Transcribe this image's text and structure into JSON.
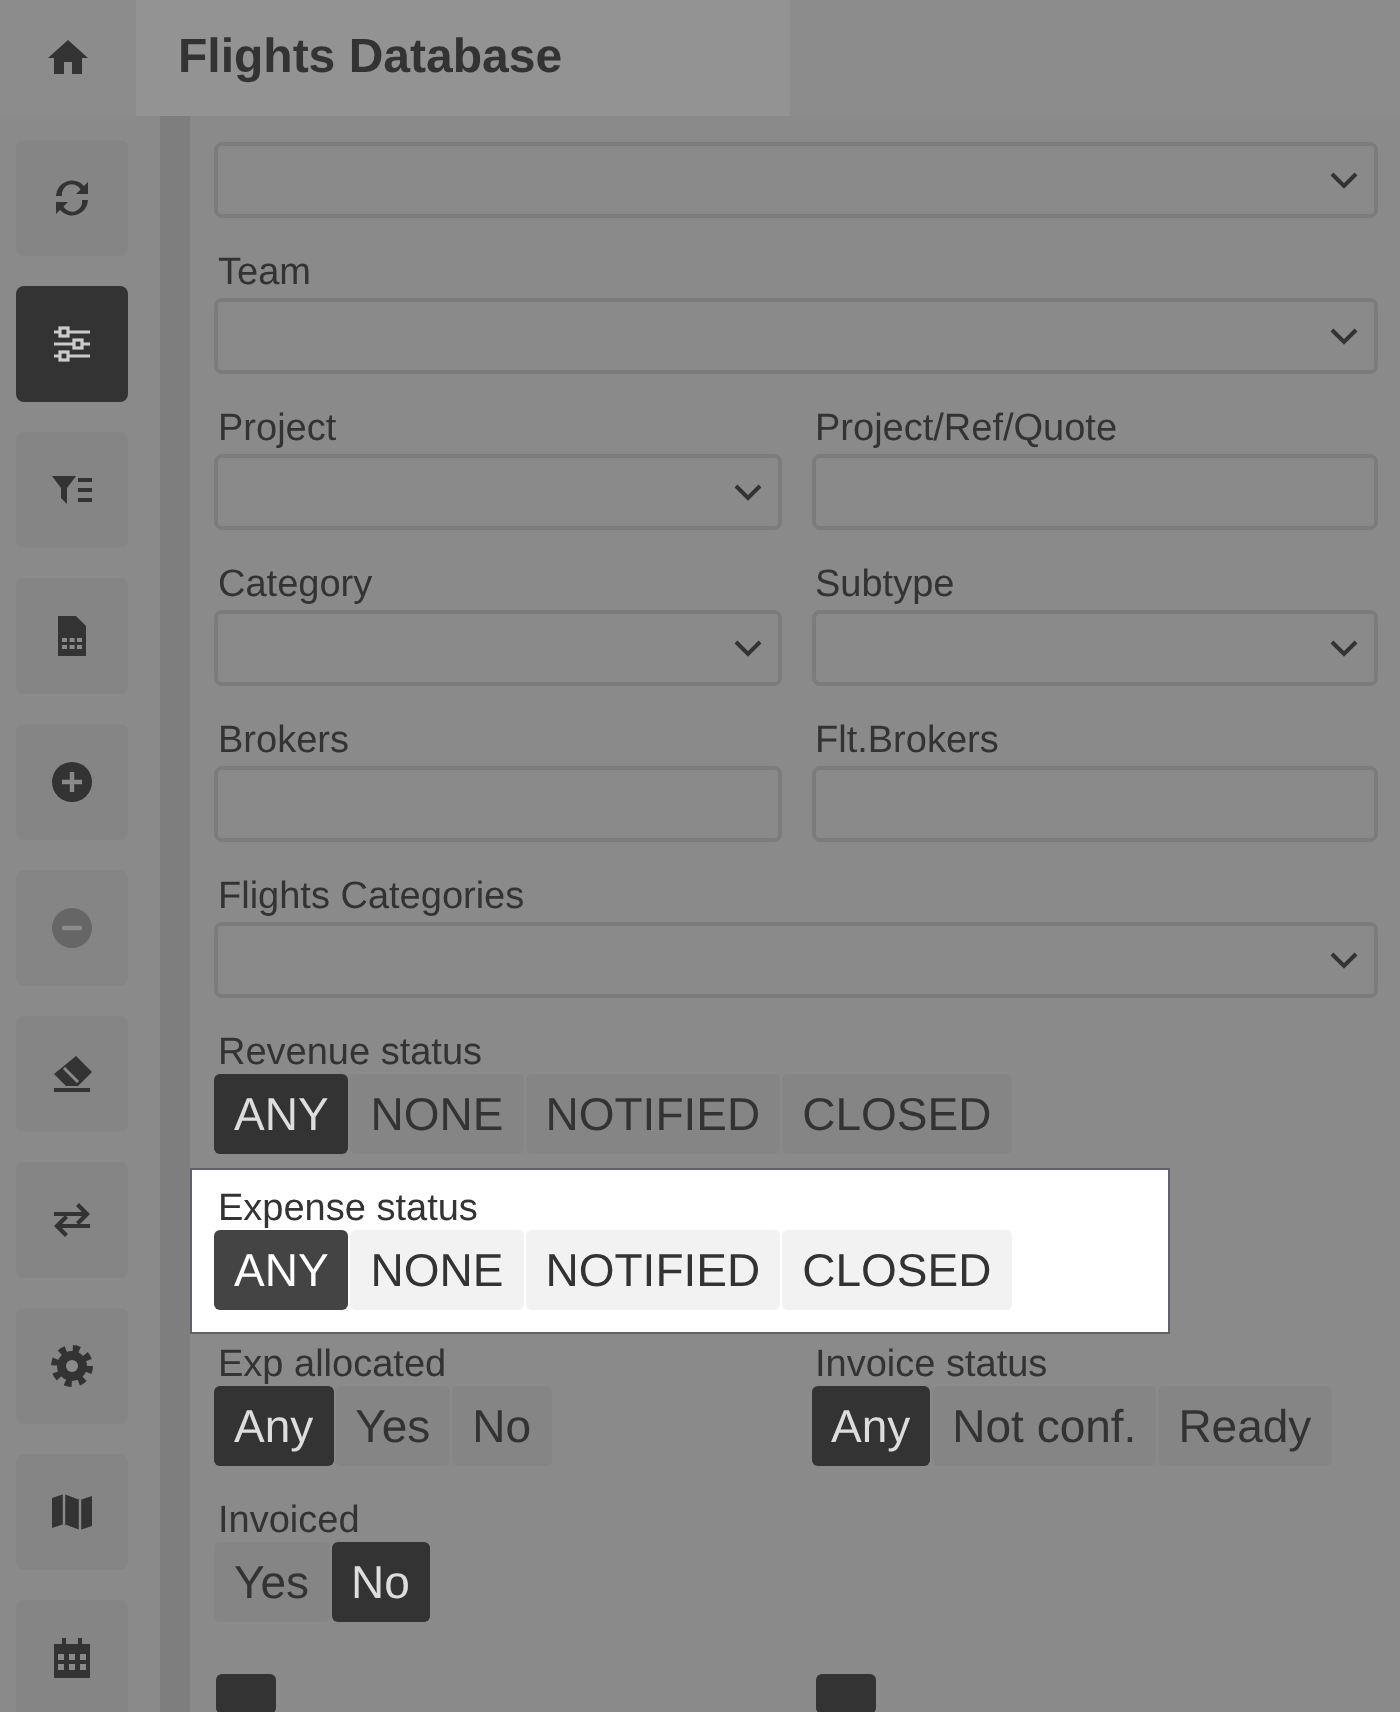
{
  "header": {
    "title": "Flights Database"
  },
  "sidebar": {
    "items": [
      {
        "selected": false,
        "disabled": false
      },
      {
        "selected": true,
        "disabled": false
      },
      {
        "selected": false,
        "disabled": false
      },
      {
        "selected": false,
        "disabled": false
      },
      {
        "selected": false,
        "disabled": false
      },
      {
        "selected": false,
        "disabled": true
      },
      {
        "selected": false,
        "disabled": false
      },
      {
        "selected": false,
        "disabled": false
      },
      {
        "selected": false,
        "disabled": false
      },
      {
        "selected": false,
        "disabled": false
      },
      {
        "selected": false,
        "disabled": false
      }
    ]
  },
  "form": {
    "rows": [
      {
        "kind": "fields",
        "fields": [
          {
            "kind": "select"
          }
        ]
      },
      {
        "kind": "fields",
        "fields": [
          {
            "label": "Team",
            "kind": "select"
          }
        ]
      },
      {
        "kind": "fields",
        "fields": [
          {
            "label": "Project",
            "kind": "select"
          },
          {
            "label": "Project/Ref/Quote",
            "kind": "text"
          }
        ]
      },
      {
        "kind": "fields",
        "fields": [
          {
            "label": "Category",
            "kind": "select"
          },
          {
            "label": "Subtype",
            "kind": "select"
          }
        ]
      },
      {
        "kind": "fields",
        "fields": [
          {
            "label": "Brokers",
            "kind": "text"
          },
          {
            "label": "Flt.Brokers",
            "kind": "text"
          }
        ]
      },
      {
        "kind": "fields",
        "fields": [
          {
            "label": "Flights Categories",
            "kind": "select"
          }
        ]
      },
      {
        "kind": "segments",
        "groups": [
          {
            "label": "Revenue status",
            "highlighted": false,
            "options": [
              {
                "label": "ANY",
                "selected": true
              },
              {
                "label": "NONE",
                "selected": false
              },
              {
                "label": "NOTIFIED",
                "selected": false
              },
              {
                "label": "CLOSED",
                "selected": false
              }
            ]
          }
        ]
      },
      {
        "kind": "segments",
        "groups": [
          {
            "label": "Expense status",
            "highlighted": true,
            "options": [
              {
                "label": "ANY",
                "selected": true
              },
              {
                "label": "NONE",
                "selected": false
              },
              {
                "label": "NOTIFIED",
                "selected": false
              },
              {
                "label": "CLOSED",
                "selected": false
              }
            ]
          }
        ]
      },
      {
        "kind": "segments",
        "groups": [
          {
            "label": "Exp allocated",
            "highlighted": false,
            "options": [
              {
                "label": "Any",
                "selected": true
              },
              {
                "label": "Yes",
                "selected": false
              },
              {
                "label": "No",
                "selected": false
              }
            ]
          },
          {
            "label": "Invoice status",
            "highlighted": false,
            "options": [
              {
                "label": "Any",
                "selected": true
              },
              {
                "label": "Not conf.",
                "selected": false
              },
              {
                "label": "Ready",
                "selected": false
              }
            ]
          }
        ]
      },
      {
        "kind": "segments",
        "groups": [
          {
            "label": "Invoiced",
            "highlighted": false,
            "options": [
              {
                "label": "Yes",
                "selected": false
              },
              {
                "label": "No",
                "selected": true
              }
            ]
          }
        ]
      },
      {
        "kind": "checkboxes",
        "items": [
          {
            "checked": true
          },
          {
            "checked": true
          }
        ]
      }
    ]
  }
}
